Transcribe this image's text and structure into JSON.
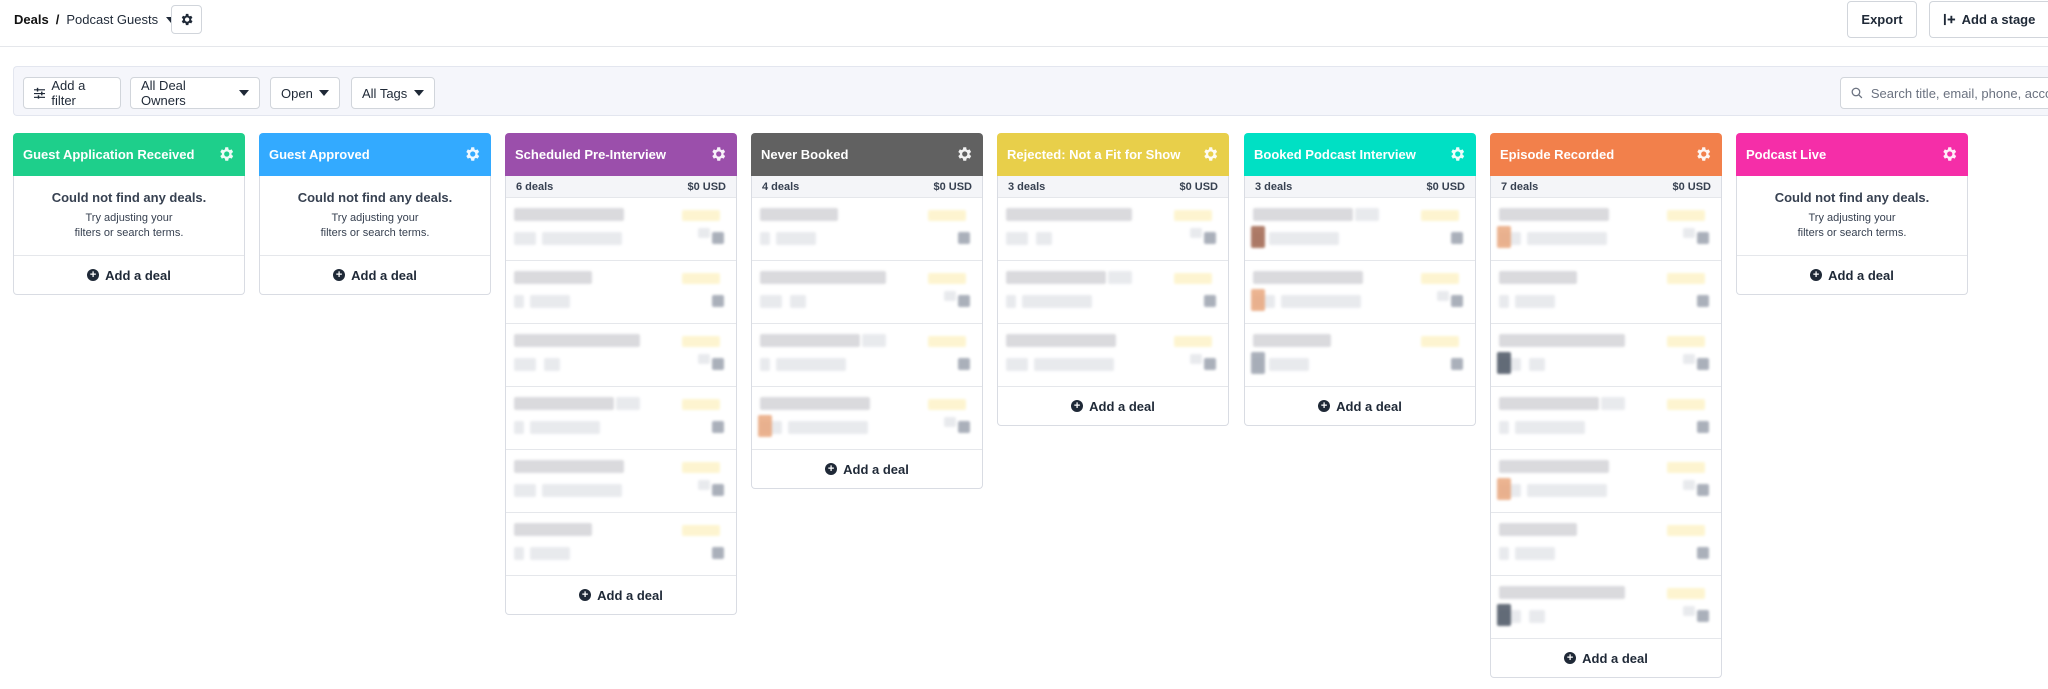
{
  "header": {
    "breadcrumb_root": "Deals",
    "breadcrumb_sep": "/",
    "pipeline_name": "Podcast Guests",
    "export_label": "Export",
    "add_stage_label": "Add a stage"
  },
  "filters": {
    "add_filter_label": "Add a filter",
    "owners_value": "All Deal Owners",
    "status_value": "Open",
    "tags_value": "All Tags",
    "search_placeholder": "Search title, email, phone, account"
  },
  "common": {
    "add_deal_label": "Add a deal",
    "empty_title": "Could not find any deals.",
    "empty_sub": "Try adjusting your filters or search terms."
  },
  "stages": [
    {
      "name": "Guest Application Received",
      "color": "#1ecf8b",
      "deals": "",
      "total": "",
      "card_count": 0
    },
    {
      "name": "Guest Approved",
      "color": "#33aaff",
      "deals": "",
      "total": "",
      "card_count": 0
    },
    {
      "name": "Scheduled Pre-Interview",
      "color": "#9b4fab",
      "deals": "6 deals",
      "total": "$0 USD",
      "card_count": 6
    },
    {
      "name": "Never Booked",
      "color": "#616161",
      "deals": "4 deals",
      "total": "$0 USD",
      "card_count": 4
    },
    {
      "name": "Rejected: Not a Fit for Show",
      "color": "#e8cf4a",
      "deals": "3 deals",
      "total": "$0 USD",
      "card_count": 3
    },
    {
      "name": "Booked Podcast Interview",
      "color": "#00e0c4",
      "deals": "3 deals",
      "total": "$0 USD",
      "card_count": 3
    },
    {
      "name": "Episode Recorded",
      "color": "#f2804b",
      "deals": "7 deals",
      "total": "$0 USD",
      "card_count": 7
    },
    {
      "name": "Podcast Live",
      "color": "#f52ea8",
      "deals": "",
      "total": "",
      "card_count": 0
    }
  ],
  "icons": {
    "settings": "gear-icon",
    "filter": "sliders-icon",
    "dropdown": "chevron-down-icon",
    "search": "search-icon",
    "add": "plus-circle-icon",
    "add_stage": "add-column-icon"
  }
}
